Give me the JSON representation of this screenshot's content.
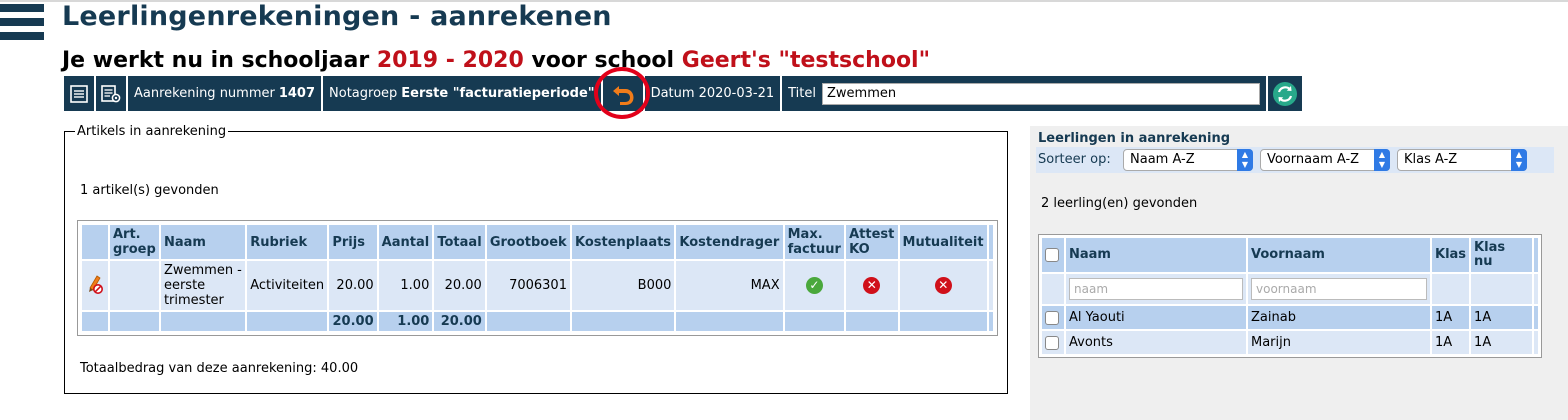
{
  "page": {
    "title": "Leerlingenrekeningen - aanrekenen",
    "school_prefix": "Je werkt nu in schooljaar",
    "school_year": "2019 - 2020",
    "school_mid": "voor school",
    "school_name": "Geert's \"testschool\""
  },
  "toolbar": {
    "aanrekening_label": "Aanrekening nummer",
    "aanrekening_nummer": "1407",
    "notagroep_label": "Notagroep",
    "notagroep_value": "Eerste \"facturatieperiode\"",
    "datum_label": "Datum",
    "datum_value": "2020-03-21",
    "titel_label": "Titel",
    "titel_value": "Zwemmen"
  },
  "artikels": {
    "legend": "Artikels in aanrekening",
    "found": "1 artikel(s) gevonden",
    "headers": {
      "art_groep_1": "Art.",
      "art_groep_2": "groep",
      "naam": "Naam",
      "rubriek": "Rubriek",
      "prijs": "Prijs",
      "aantal": "Aantal",
      "totaal": "Totaal",
      "grootboek": "Grootboek",
      "kostenplaats": "Kostenplaats",
      "kostendrager": "Kostendrager",
      "max_factuur_1": "Max.",
      "max_factuur_2": "factuur",
      "attest_ko_1": "Attest",
      "attest_ko_2": "KO",
      "mutualiteit": "Mutualiteit"
    },
    "rows": [
      {
        "art_groep": "",
        "naam_1": "Zwemmen -",
        "naam_2": "eerste",
        "naam_3": "trimester",
        "rubriek": "Activiteiten",
        "prijs": "20.00",
        "aantal": "1.00",
        "totaal": "20.00",
        "grootboek": "7006301",
        "kostenplaats": "B000",
        "kostendrager": "MAX",
        "max_factuur": "check-circle-icon",
        "attest_ko": "x-circle-icon",
        "mutualiteit": "x-circle-icon"
      }
    ],
    "totals": {
      "prijs": "20.00",
      "aantal": "1.00",
      "totaal": "20.00"
    },
    "total_line": "Totaalbedrag van deze aanrekening: 40.00"
  },
  "leerlingen": {
    "title": "Leerlingen in aanrekening",
    "sort_label": "Sorteer op:",
    "sort_1": "Naam A-Z",
    "sort_2": "Voornaam A-Z",
    "sort_3": "Klas A-Z",
    "found": "2 leerling(en) gevonden",
    "headers": {
      "naam": "Naam",
      "voornaam": "Voornaam",
      "klas": "Klas",
      "klas_nu_1": "Klas",
      "klas_nu_2": "nu"
    },
    "filter_naam_placeholder": "naam",
    "filter_voornaam_placeholder": "voornaam",
    "rows": [
      {
        "naam": "Al Yaouti",
        "voornaam": "Zainab",
        "klas": "1A",
        "klas_nu": "1A"
      },
      {
        "naam": "Avonts",
        "voornaam": "Marijn",
        "klas": "1A",
        "klas_nu": "1A"
      }
    ]
  },
  "colors": {
    "dark_blue": "#163a52",
    "accent_red": "#c0101a",
    "highlight_ring": "#e2001a",
    "header_blue": "#b7d0ee",
    "row_blue": "#dce7f6",
    "undo_orange": "#f07c1a",
    "refresh_green": "#27a88a"
  }
}
